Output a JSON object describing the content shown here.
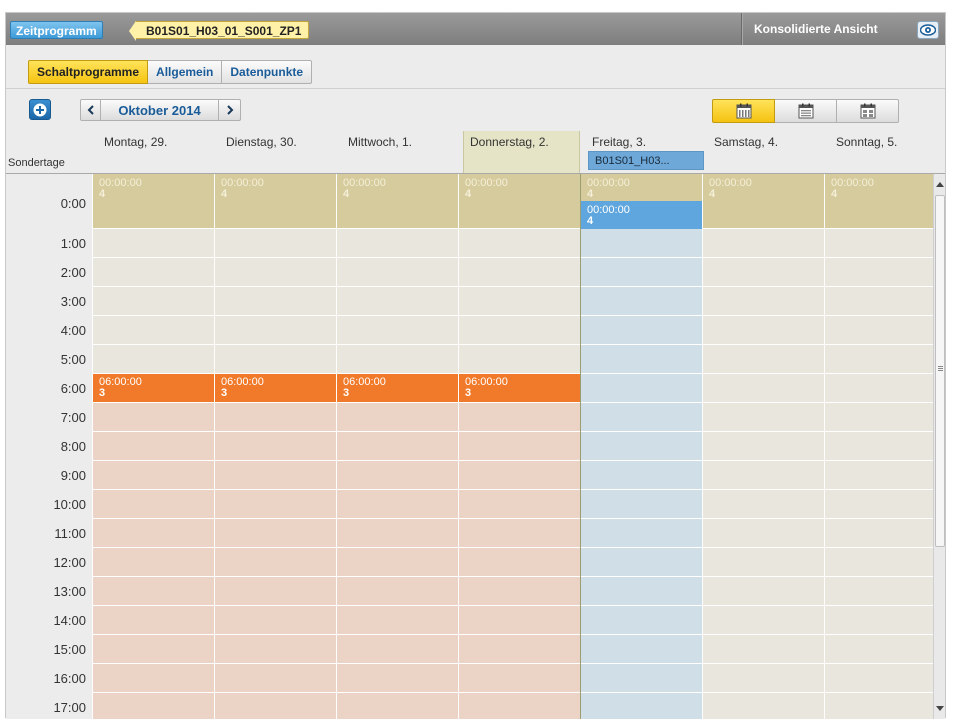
{
  "titlebar": {
    "root_crumb": "Zeitprogramm",
    "item_crumb": "B01S01_H03_01_S001_ZP1",
    "consolidated_label": "Konsolidierte Ansicht",
    "eye_icon": "eye-icon"
  },
  "tabs": [
    {
      "label": "Schaltprogramme",
      "active": true
    },
    {
      "label": "Allgemein",
      "active": false
    },
    {
      "label": "Datenpunkte",
      "active": false
    }
  ],
  "toolbar": {
    "month_label": "Oktober 2014",
    "add_icon": "plus-circle-icon",
    "prev_icon": "chevron-left-icon",
    "next_icon": "chevron-right-icon",
    "views": [
      {
        "icon": "calendar-week-icon",
        "active": true
      },
      {
        "icon": "calendar-month-icon",
        "active": false
      },
      {
        "icon": "calendar-year-icon",
        "active": false
      }
    ]
  },
  "calendar": {
    "special_days_label": "Sondertage",
    "today_index": 3,
    "days": [
      {
        "label": "Montag, 29."
      },
      {
        "label": "Dienstag, 30."
      },
      {
        "label": "Mittwoch, 1."
      },
      {
        "label": "Donnerstag, 2."
      },
      {
        "label": "Freitag, 3."
      },
      {
        "label": "Samstag, 4."
      },
      {
        "label": "Sonntag, 5."
      }
    ],
    "special_day_chip": "B01S01_H03...",
    "hours": [
      "0:00",
      "1:00",
      "2:00",
      "3:00",
      "4:00",
      "5:00",
      "6:00",
      "7:00",
      "8:00",
      "9:00",
      "10:00",
      "11:00",
      "12:00",
      "13:00",
      "14:00",
      "15:00",
      "16:00",
      "17:00"
    ],
    "events": {
      "midnight_time": "00:00:00",
      "midnight_value": "4",
      "six_time": "06:00:00",
      "six_value": "3",
      "friday_special_time": "00:00:00",
      "friday_special_value": "4"
    },
    "colors": {
      "khaki": "#d6cb9d",
      "salmon": "#ebd4c6",
      "orange": "#f07a2a",
      "blue_day": "#d0dee8",
      "blue_event": "#5fa6de",
      "neutral": "#e9e6de"
    }
  }
}
